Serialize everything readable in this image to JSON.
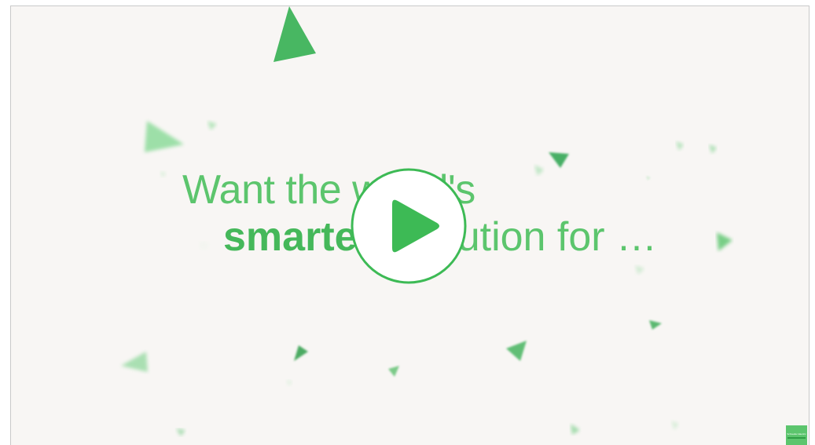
{
  "video": {
    "headline_line1": "Want the world's",
    "headline_line2_bold": "smartest",
    "headline_line2_rest": " solution for …",
    "accent_color": "#4cbf5f",
    "background_color": "#f8f6f4"
  },
  "player": {
    "play_icon": "play-icon"
  },
  "brand": {
    "logo_text": "Schneider Electric"
  }
}
